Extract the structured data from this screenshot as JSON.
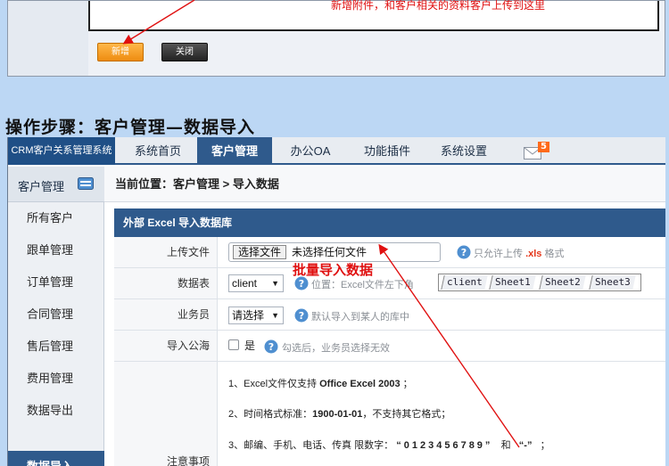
{
  "top": {
    "annotation": "新增附件，和客户相关的资料客户上传到这里",
    "buttons": {
      "new": "新增",
      "close": "关闭"
    }
  },
  "heading": "操作步骤：客户管理—数据导入",
  "nav": {
    "brand": "CRM客户关系管理系统",
    "tabs": [
      {
        "label": "系统首页",
        "active": false
      },
      {
        "label": "客户管理",
        "active": true
      },
      {
        "label": "办公OA",
        "active": false
      },
      {
        "label": "功能插件",
        "active": false
      },
      {
        "label": "系统设置",
        "active": false
      }
    ],
    "mail_badge": "5",
    "mail_icon": "mail-icon"
  },
  "sidebar": {
    "title": "客户管理",
    "items": [
      {
        "label": "所有客户",
        "active": false
      },
      {
        "label": "跟单管理",
        "active": false
      },
      {
        "label": "订单管理",
        "active": false
      },
      {
        "label": "合同管理",
        "active": false
      },
      {
        "label": "售后管理",
        "active": false
      },
      {
        "label": "费用管理",
        "active": false
      },
      {
        "label": "数据导出",
        "active": false
      },
      {
        "label": "数据导入",
        "active": true
      }
    ]
  },
  "breadcrumb": {
    "prefix": "当前位置：",
    "path": "客户管理 > 导入数据"
  },
  "form": {
    "header": "外部 Excel 导入数据库",
    "upload": {
      "label": "上传文件",
      "button": "选择文件",
      "status": "未选择任何文件",
      "hint_prefix": "只允许上传",
      "hint_ext": ".xls",
      "hint_suffix": "格式"
    },
    "sheet": {
      "label": "数据表",
      "value": "client",
      "hint": "位置：Excel文件左下角",
      "strip": [
        "client",
        "Sheet1",
        "Sheet2",
        "Sheet3"
      ]
    },
    "owner": {
      "label": "业务员",
      "value": "请选择",
      "hint": "默认导入到某人的库中"
    },
    "public_pool": {
      "label": "导入公海",
      "checkbox_label": "是",
      "hint": "勾选后，业务员选择无效"
    },
    "notes": {
      "label": "注意事项",
      "line1_prefix": "1、Excel文件仅支持",
      "line1_bold": "Office Excel 2003",
      "line1_suffix": "；",
      "line2_prefix": "2、时间格式标准：",
      "line2_bold": "1900-01-01",
      "line2_suffix": "，不支持其它格式；",
      "line3_prefix": "3、邮编、手机、电话、传真 限数字：",
      "line3_digits": "“0123456789”",
      "line3_and": "和",
      "line3_dash": "“-”",
      "line3_suffix": "；"
    }
  },
  "annotation_batch": "批量导入数据",
  "colors": {
    "nav_blue": "#2f5a8c",
    "brand_blue": "#1f4f86",
    "annotation_red": "#e01010",
    "new_orange": "#f39a1e",
    "background": "#bcd7f4"
  }
}
